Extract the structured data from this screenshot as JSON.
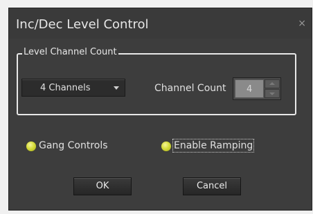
{
  "dialog": {
    "title": "Inc/Dec Level Control",
    "close_glyph": "×"
  },
  "level_channel_group": {
    "label": "Level Channel Count",
    "channels_dropdown": {
      "selected": "4 Channels",
      "icon": "chevron-down-icon"
    },
    "channel_count": {
      "label": "Channel Count",
      "value": "4"
    }
  },
  "options": {
    "gang_controls": {
      "label": "Gang Controls",
      "checked": true
    },
    "enable_ramping": {
      "label": "Enable Ramping",
      "checked": true
    }
  },
  "buttons": {
    "ok": "OK",
    "cancel": "Cancel"
  },
  "colors": {
    "dialog_bg": "#3d3d3d",
    "led": "#d6dc3c",
    "text": "#e0e0e0"
  }
}
